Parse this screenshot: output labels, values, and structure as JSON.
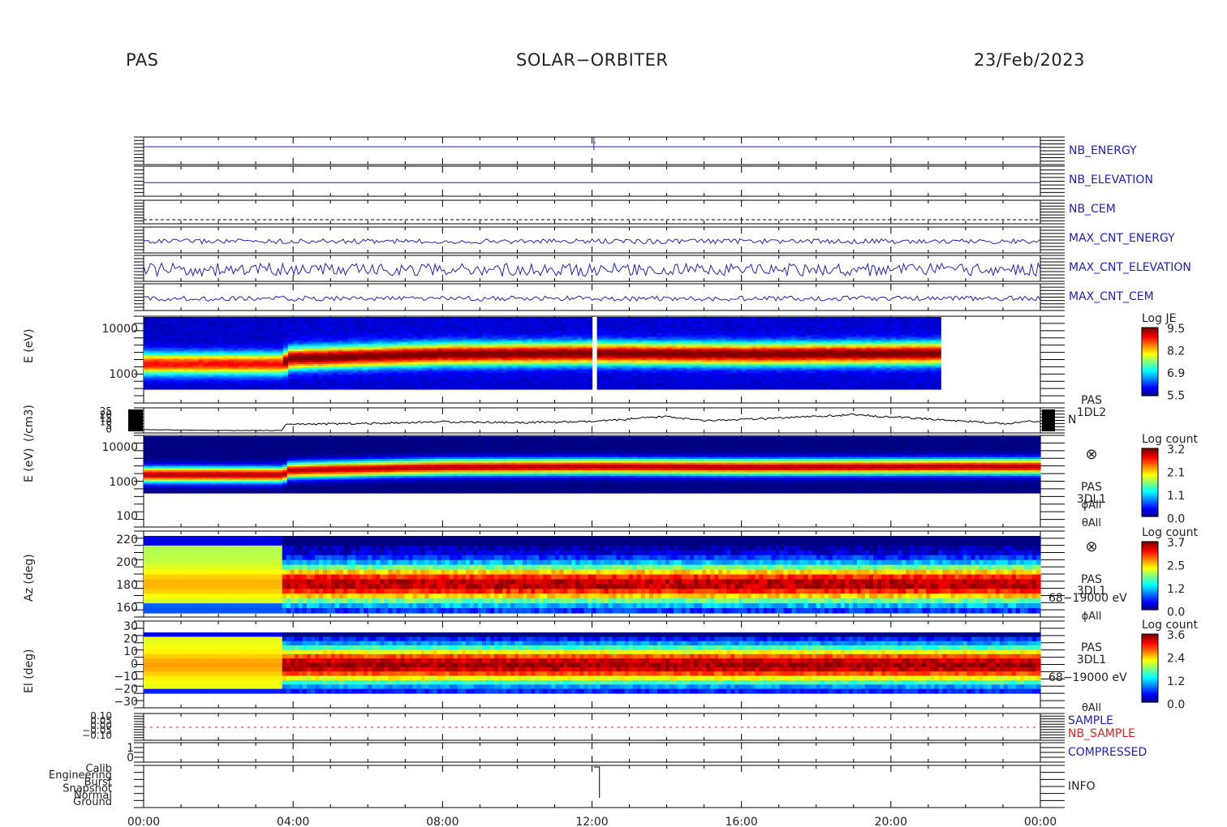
{
  "header": {
    "instrument": "PAS",
    "mission": "SOLAR−ORBITER",
    "date": "23/Feb/2023"
  },
  "colors": {
    "housekeeping_trace": "#2020c0",
    "sample_label": "#2020c0",
    "nb_sample_label": "#e02020",
    "density_trace": "#000000"
  },
  "chart_data": {
    "type": "heatmap",
    "x_axis": {
      "range_hours": [
        0,
        24
      ],
      "tick_labels": [
        "00:00",
        "04:00",
        "08:00",
        "12:00",
        "16:00",
        "20:00",
        "00:00"
      ]
    },
    "housekeeping_panels": [
      {
        "name": "NB_ENERGY"
      },
      {
        "name": "NB_ELEVATION"
      },
      {
        "name": "NB_CEM"
      },
      {
        "name": "MAX_CNT_ENERGY"
      },
      {
        "name": "MAX_CNT_ELEVATION"
      },
      {
        "name": "MAX_CNT_CEM"
      }
    ],
    "energy_flux_spectrogram": {
      "ylabel": "E (eV)",
      "yscale": "log",
      "yticks": [
        "10000",
        "1000"
      ],
      "colorbar": {
        "title": "Log JE",
        "ticks": [
          "9.5",
          "8.2",
          "6.9",
          "5.5"
        ],
        "range": [
          5.5,
          9.5
        ]
      },
      "data_end_hour": 21.3,
      "peak_energy_eV": [
        [
          0,
          1500
        ],
        [
          3.7,
          1500
        ],
        [
          3.8,
          2000
        ],
        [
          8,
          2500
        ],
        [
          12,
          2600
        ],
        [
          16,
          2500
        ],
        [
          21.3,
          2600
        ]
      ]
    },
    "density": {
      "ylabel": "(/cm3)",
      "yticks": [
        "25",
        "20",
        "15",
        "10",
        "5",
        "0"
      ],
      "label": "N",
      "product": [
        "PAS",
        "1DL2"
      ],
      "points": [
        [
          0,
          2
        ],
        [
          2,
          1
        ],
        [
          3.7,
          1
        ],
        [
          3.8,
          8
        ],
        [
          6,
          9
        ],
        [
          8,
          11
        ],
        [
          10,
          10
        ],
        [
          12,
          11
        ],
        [
          14,
          17
        ],
        [
          15,
          12
        ],
        [
          17,
          15
        ],
        [
          19,
          19
        ],
        [
          21,
          14
        ],
        [
          23,
          9
        ],
        [
          24,
          12
        ]
      ]
    },
    "count_spectrogram": {
      "ylabel": "E (eV)",
      "yticks": [
        "10000",
        "1000",
        "100"
      ],
      "colorbar": {
        "title": "Log count",
        "ticks": [
          "3.2",
          "2.1",
          "1.1",
          "0.0"
        ]
      },
      "labels": [
        "⊗",
        "PAS",
        "3DL1",
        "ϕAll",
        "θAll"
      ]
    },
    "azimuth_spectrogram": {
      "ylabel": "Az (deg)",
      "yticks": [
        "220",
        "200",
        "180",
        "160"
      ],
      "colorbar": {
        "title": "Log count",
        "ticks": [
          "3.7",
          "2.5",
          "1.2",
          "0.0"
        ]
      },
      "labels": [
        "⊗",
        "PAS",
        "3DL1",
        "68−19000 eV",
        "ϕAll"
      ]
    },
    "elevation_spectrogram": {
      "ylabel": "El (deg)",
      "yticks": [
        "30",
        "20",
        "10",
        "0",
        "−10",
        "−20",
        "−30"
      ],
      "colorbar": {
        "title": "Log count",
        "ticks": [
          "3.6",
          "2.4",
          "1.2",
          "0.0"
        ]
      },
      "labels": [
        "PAS",
        "3DL1",
        "68−19000 eV",
        "θAll"
      ]
    },
    "sample_panel": {
      "labels": [
        "SAMPLE",
        "NB_SAMPLE"
      ],
      "yticks": [
        "0.10",
        "0.05",
        "0.00",
        "−0.05",
        "−0.10"
      ]
    },
    "compressed_panel": {
      "label": "COMPRESSED",
      "yticks": [
        "1",
        "0"
      ]
    },
    "info_panel": {
      "label": "INFO",
      "modes": [
        "Calib",
        "Engineering",
        "Burst",
        "Snapshot",
        "Normal",
        "Ground"
      ]
    }
  }
}
